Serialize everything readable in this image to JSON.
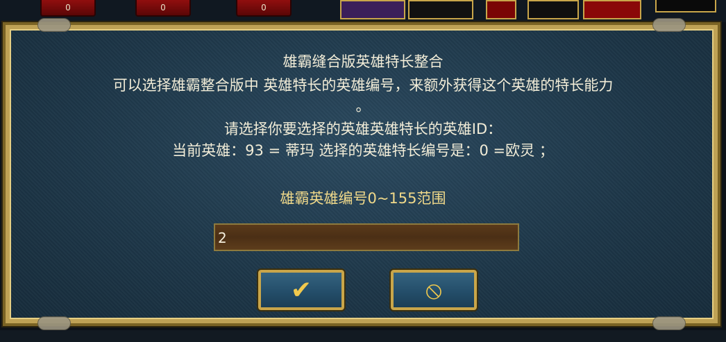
{
  "top_bar": {
    "buttons": [
      {
        "label": "0"
      },
      {
        "label": "0"
      },
      {
        "label": "0"
      }
    ]
  },
  "dialog": {
    "title": "雄霸缝合版英雄特长整合",
    "description": "可以选择雄霸整合版中 英雄特长的英雄编号，来额外获得这个英雄的特长能力",
    "description_end": "。",
    "prompt": "请选择你要选择的英雄英雄特长的英雄ID：",
    "current_line": "当前英雄：93 = 蒂玛 选择的英雄特长编号是：0 =欧灵 ；",
    "range_label": "雄霸英雄编号0~155范围",
    "input_value": "2",
    "confirm_icon": "checkmark-icon",
    "cancel_icon": "prohibited-icon"
  },
  "colors": {
    "panel": "#1d3648",
    "gold_border": "#c9a64a",
    "text": "#f2edd8",
    "range_text": "#f0d98a",
    "input_bg": "#4b2f15",
    "button_bg": "#244e6a",
    "icon": "#f1c94d"
  }
}
